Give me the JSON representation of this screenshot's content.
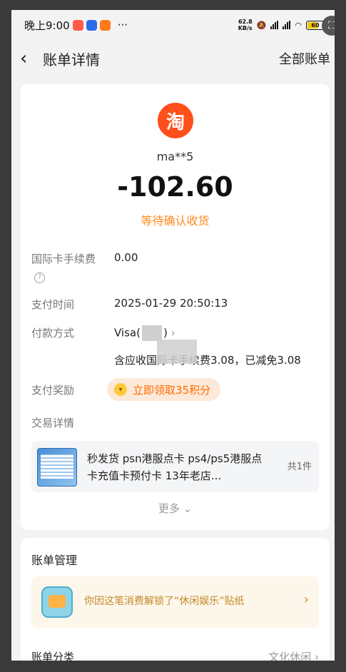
{
  "status_bar": {
    "time": "晚上9:00",
    "more": "···",
    "speed_top": "62.8",
    "speed_bottom": "KB/s",
    "battery": "60"
  },
  "navbar": {
    "title": "账单详情",
    "all_bills": "全部账单"
  },
  "bill": {
    "merchant_logo": "淘",
    "merchant": "ma**5",
    "amount": "-102.60",
    "status": "等待确认收货"
  },
  "details": {
    "fee_label": "国际卡手续费",
    "fee_value": "0.00",
    "time_label": "支付时间",
    "time_value": "2025-01-29 20:50:13",
    "method_label": "付款方式",
    "method_prefix": "Visa(",
    "method_suffix": ")",
    "fee_note": "含应收国际卡手续费3.08，已减免3.08",
    "reward_label": "支付奖励",
    "reward_text": "立即领取35积分",
    "trade_label": "交易详情"
  },
  "product": {
    "title": "秒发货 psn港服点卡 ps4/ps5港服点卡充值卡预付卡 13年老店...",
    "count": "共1件"
  },
  "more": "更多",
  "management": {
    "title": "账单管理",
    "sticker_text": "你因这笔消费解锁了“休闲娱乐”贴纸",
    "category_label": "账单分类",
    "category_value": "文化休闲"
  }
}
